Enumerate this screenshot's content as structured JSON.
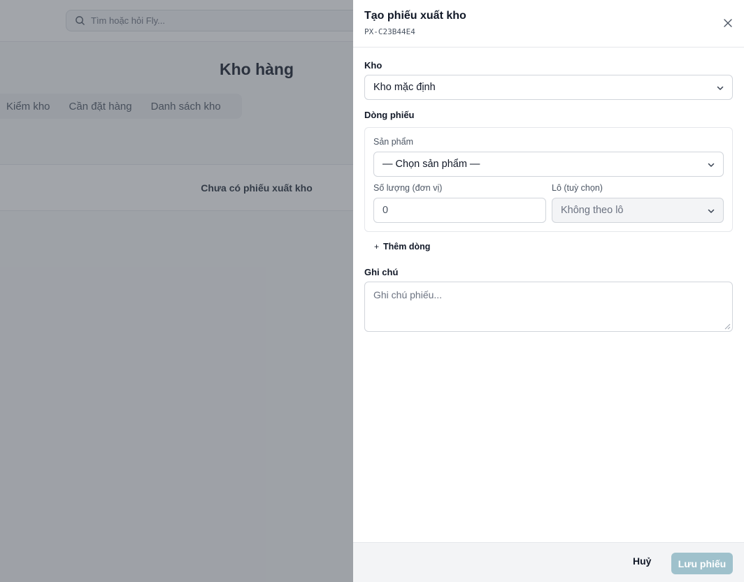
{
  "background": {
    "search_placeholder": "Tìm hoặc hỏi Fly...",
    "page_title": "Kho hàng",
    "tabs": [
      {
        "label": "Kiểm kho"
      },
      {
        "label": "Cần đặt hàng"
      },
      {
        "label": "Danh sách kho"
      }
    ],
    "empty_message": "Chưa có phiếu xuất kho"
  },
  "drawer": {
    "title": "Tạo phiếu xuất kho",
    "code": "PX-C23B44E4",
    "warehouse": {
      "label": "Kho",
      "value": "Kho mặc định"
    },
    "lines": {
      "label": "Dòng phiếu",
      "product_label": "Sản phẩm",
      "product_value": "— Chọn sản phẩm —",
      "quantity_label": "Số lượng (đơn vị)",
      "quantity_value": "0",
      "lot_label": "Lô (tuỳ chọn)",
      "lot_value": "Không theo lô"
    },
    "add_line_label": "Thêm dòng",
    "note": {
      "label": "Ghi chú",
      "placeholder": "Ghi chú phiếu..."
    },
    "footer": {
      "cancel_label": "Huỷ",
      "save_label": "Lưu phiếu"
    }
  },
  "colors": {
    "save_button_disabled": "#9fc1cc",
    "overlay": "#464b55"
  }
}
